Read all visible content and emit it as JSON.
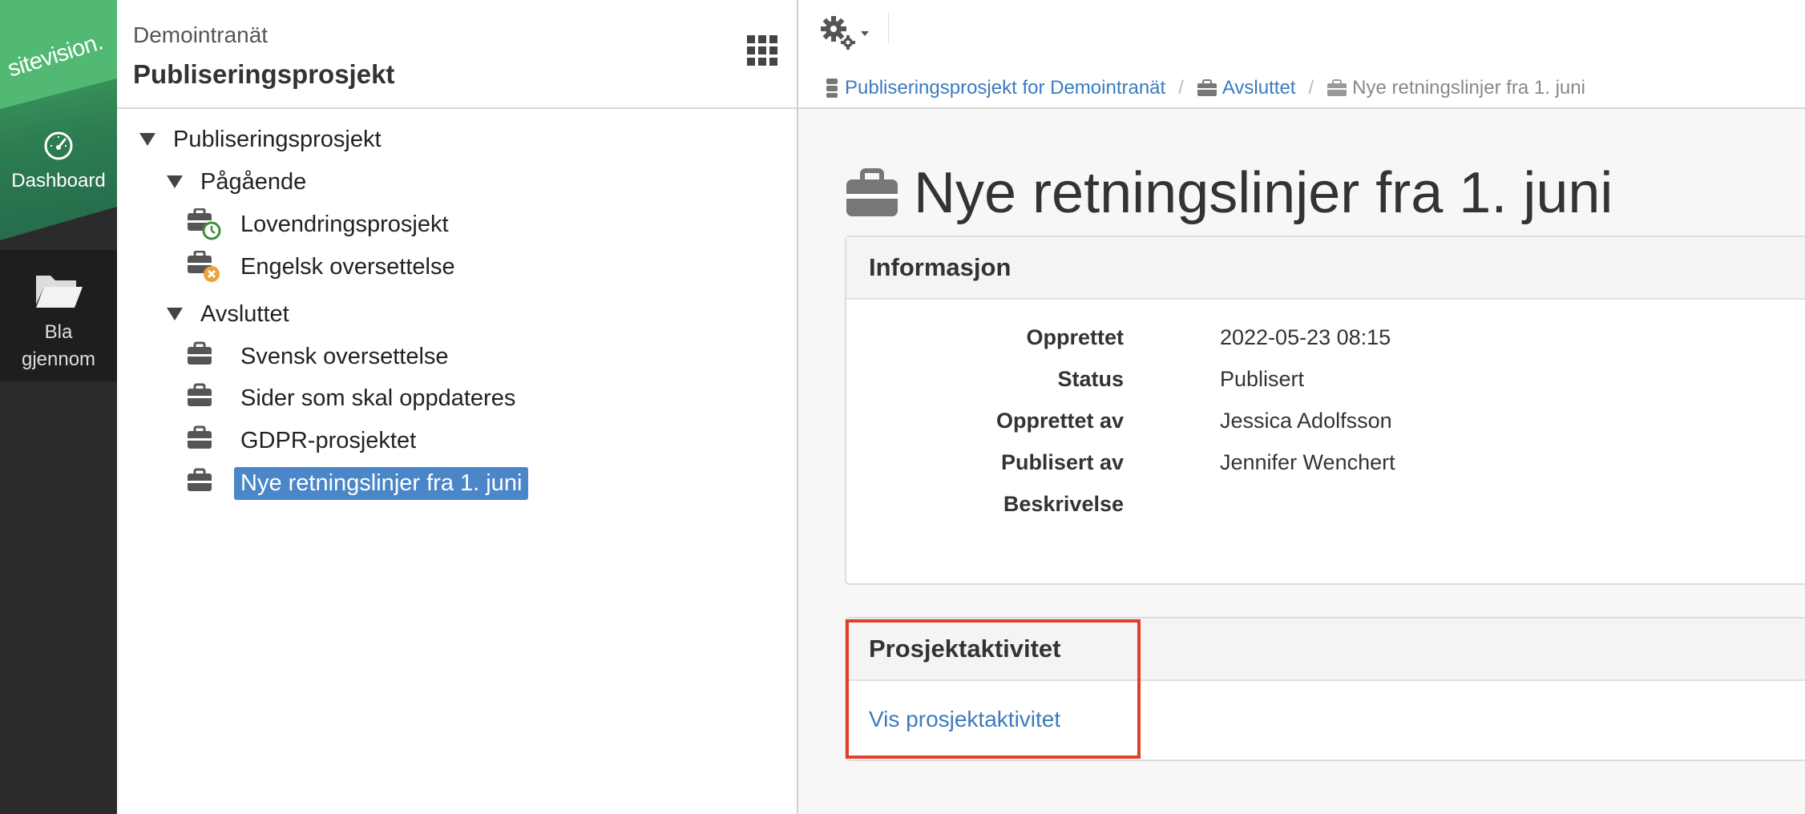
{
  "rail": {
    "logo": "sitevision.",
    "dashboard_label": "Dashboard",
    "browse_label_1": "Bla",
    "browse_label_2": "gjennom"
  },
  "tree_header": {
    "site_name": "Demointranät",
    "project_name": "Publiseringsprosjekt"
  },
  "tree": {
    "root": "Publiseringsprosjekt",
    "groups": [
      {
        "label": "Pågående",
        "items": [
          "Lovendringsprosjekt",
          "Engelsk oversettelse"
        ]
      },
      {
        "label": "Avsluttet",
        "items": [
          "Svensk oversettelse",
          "Sider som skal oppdateres",
          "GDPR-prosjektet",
          "Nye retningslinjer fra 1. juni"
        ]
      }
    ],
    "selected": "Nye retningslinjer fra 1. juni"
  },
  "breadcrumb": [
    "Publiseringsprosjekt for Demointranät",
    "Avsluttet",
    "Nye retningslinjer fra 1. juni"
  ],
  "page": {
    "title": "Nye retningslinjer fra 1. juni"
  },
  "info": {
    "heading": "Informasjon",
    "rows": [
      {
        "key": "Opprettet",
        "value": "2022-05-23 08:15"
      },
      {
        "key": "Status",
        "value": "Publisert"
      },
      {
        "key": "Opprettet av",
        "value": "Jessica Adolfsson"
      },
      {
        "key": "Publisert av",
        "value": "Jennifer Wenchert"
      },
      {
        "key": "Beskrivelse",
        "value": ""
      }
    ]
  },
  "activity": {
    "heading": "Prosjektaktivitet",
    "link": "Vis prosjektaktivitet"
  },
  "colors": {
    "accent_blue": "#3a7bc0",
    "selected_bg": "#4a86c8",
    "brand_green": "#52b974",
    "highlight_red": "#e0402a"
  }
}
